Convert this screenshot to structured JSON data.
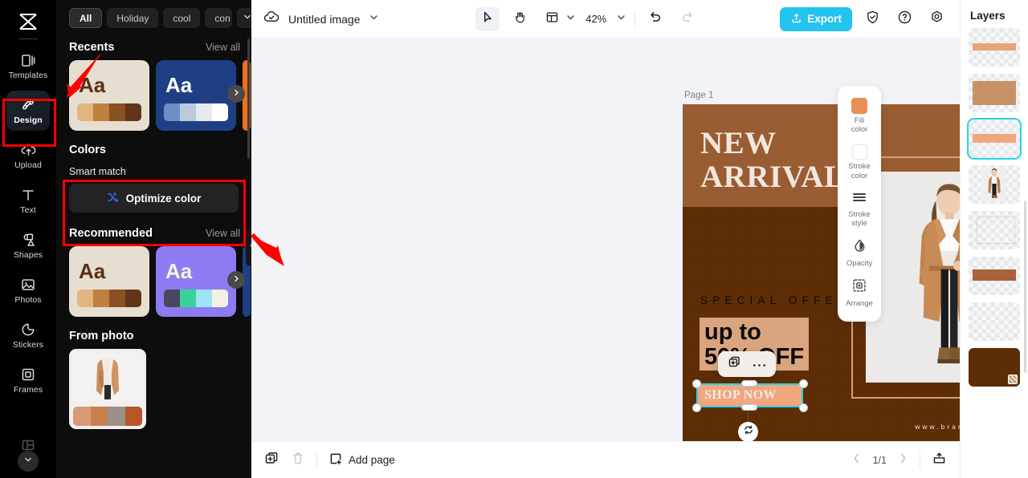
{
  "app": {
    "name": "CapCut",
    "logo_icon": "capcut-logo-icon"
  },
  "rail": {
    "items": [
      {
        "label": "Templates",
        "icon": "templates-icon",
        "active": false
      },
      {
        "label": "Design",
        "icon": "design-icon",
        "active": true
      },
      {
        "label": "Upload",
        "icon": "upload-icon",
        "active": false
      },
      {
        "label": "Text",
        "icon": "text-icon",
        "active": false
      },
      {
        "label": "Shapes",
        "icon": "shapes-icon",
        "active": false
      },
      {
        "label": "Photos",
        "icon": "photos-icon",
        "active": false
      },
      {
        "label": "Stickers",
        "icon": "stickers-icon",
        "active": false
      },
      {
        "label": "Frames",
        "icon": "frames-icon",
        "active": false
      }
    ],
    "more_icon": "chevron-down-icon"
  },
  "panel": {
    "chips": [
      {
        "label": "All",
        "selected": true
      },
      {
        "label": "Holiday",
        "selected": false
      },
      {
        "label": "cool",
        "selected": false
      },
      {
        "label": "con",
        "selected": false
      }
    ],
    "chips_more_icon": "chevron-down-icon",
    "collapse_icon": "chevron-left-icon",
    "recents": {
      "title": "Recents",
      "view_all": "View all",
      "next_icon": "chevron-right-icon",
      "cards": [
        {
          "sample_text": "Aa",
          "bg": "#e7ded2",
          "text_color": "#5a3113",
          "swatches": [
            "#e2b581",
            "#c0803e",
            "#8a5122",
            "#5f3617"
          ]
        },
        {
          "sample_text": "Aa",
          "bg": "#1f3f85",
          "text_color": "#ffffff",
          "swatches": [
            "#6a90c6",
            "#b9cada",
            "#e6eaee",
            "#ffffff"
          ]
        },
        {
          "sample_text": "",
          "bg": "#ef6f1a",
          "text_color": "#ffffff",
          "swatches": []
        }
      ]
    },
    "colors_title": "Colors",
    "smart_match": {
      "label": "Smart match",
      "button_label": "Optimize color",
      "button_icon": "shuffle-icon",
      "icon_color": "#2f6bff"
    },
    "recommended": {
      "title": "Recommended",
      "view_all": "View all",
      "next_icon": "chevron-right-icon",
      "cards": [
        {
          "sample_text": "Aa",
          "bg": "#e7ded2",
          "text_color": "#5a3113",
          "swatches": [
            "#e2b581",
            "#c0803e",
            "#8a5122",
            "#5f3617"
          ]
        },
        {
          "sample_text": "Aa",
          "bg": "#8d7bf2",
          "text_color": "#f7f3e6",
          "swatches": [
            "#4b4660",
            "#3bd29a",
            "#9fe3f7",
            "#f4f0e2"
          ]
        },
        {
          "sample_text": "",
          "bg": "#1f3f85",
          "text_color": "#ffffff",
          "swatches": []
        }
      ]
    },
    "from_photo": {
      "title": "From photo",
      "swatches": [
        "#d79a74",
        "#c97e4e",
        "#9b9189",
        "#b5572a"
      ]
    }
  },
  "topbar": {
    "cloud_icon": "cloud-saved-icon",
    "doc_title": "Untitled image",
    "title_caret_icon": "chevron-down-icon",
    "tools": [
      {
        "name": "select-tool",
        "icon": "cursor-arrow-icon",
        "active": true
      },
      {
        "name": "hand-tool",
        "icon": "hand-icon",
        "active": false
      },
      {
        "name": "layout-tool",
        "icon": "layout-icon",
        "active": false
      }
    ],
    "layout_caret_icon": "chevron-down-icon",
    "zoom_value": "42%",
    "zoom_caret_icon": "chevron-down-icon",
    "undo_icon": "undo-icon",
    "redo_icon": "redo-icon",
    "export_label": "Export",
    "export_icon": "export-upload-icon",
    "export_color": "#22c3ee",
    "shield_icon": "shield-check-icon",
    "help_icon": "question-circle-icon",
    "settings_icon": "gear-icon"
  },
  "canvas": {
    "page_label": "Page 1",
    "page_duplicate_icon": "duplicate-page-icon",
    "page_more_icon": "more-horizontal-icon",
    "poster": {
      "top_bg": "#9a5c32",
      "bottom_bg": "#5d2d06",
      "frame_color": "#d7a070",
      "headline": "NEW\nARRIVAL",
      "headline_color": "#f0e6dc",
      "special_offer": "SPECIAL OFFER",
      "special_color": "#120a04",
      "offer_text": "up to\n50% OFF",
      "offer_text_color": "#0e0906",
      "offer_box_color": "#d9a57e",
      "cta_text": "SHOP NOW",
      "cta_fill": "#f0a67f",
      "cta_text_color": "#f3ece8",
      "brand_url": "www.brandname.com",
      "brand_url_color": "#eee5dd",
      "brand_highlight_color": "#f0a67f"
    },
    "context_toolbar": {
      "duplicate_icon": "duplicate-icon",
      "more_icon": "more-horizontal-icon"
    },
    "selection": {
      "border_color": "#2ad4e0",
      "rotate_icon": "rotate-icon"
    }
  },
  "float_tools": {
    "items": [
      {
        "label": "Fill\ncolor",
        "icon": "fill-color-swatch-icon",
        "color": "#e89055"
      },
      {
        "label": "Stroke\ncolor",
        "icon": "stroke-color-swatch-icon",
        "color": "#ffffff"
      },
      {
        "label": "Stroke\nstyle",
        "icon": "stroke-style-icon",
        "color": "#3b4149"
      },
      {
        "label": "Opacity",
        "icon": "opacity-droplet-icon",
        "color": "#3b4149"
      },
      {
        "label": "Arrange",
        "icon": "arrange-icon",
        "color": "#3b4149"
      }
    ]
  },
  "layers": {
    "title": "Layers",
    "items": [
      {
        "name": "layer-bar-peach",
        "kind": "bar",
        "color": "#e8a379",
        "selected": false
      },
      {
        "name": "layer-block-tan",
        "kind": "block",
        "color": "#c79366",
        "selected": false
      },
      {
        "name": "layer-bar-salmon",
        "kind": "bar",
        "color": "#f0a67f",
        "selected": true
      },
      {
        "name": "layer-model-photo",
        "kind": "photo",
        "color": "#c08a5a",
        "selected": false
      },
      {
        "name": "layer-frame-outline",
        "kind": "frame",
        "color": "#e7d4c2",
        "selected": false
      },
      {
        "name": "layer-bar-brown",
        "kind": "bar",
        "color": "#a9623a",
        "selected": false
      },
      {
        "name": "layer-empty",
        "kind": "empty",
        "color": "#f0f1f2",
        "selected": false
      },
      {
        "name": "layer-background-dark",
        "kind": "full",
        "color": "#5d2d06",
        "selected": false
      }
    ]
  },
  "bottombar": {
    "duplicate_icon": "duplicate-page-icon",
    "delete_icon": "trash-icon",
    "add_page_label": "Add page",
    "add_page_icon": "add-page-icon",
    "prev_icon": "chevron-left-icon",
    "next_icon": "chevron-right-icon",
    "page_indicator": "1/1",
    "present_icon": "present-icon"
  },
  "annotations": {
    "color": "#ff0000",
    "targets": [
      "design-sidebar-item",
      "smart-match-section"
    ]
  }
}
